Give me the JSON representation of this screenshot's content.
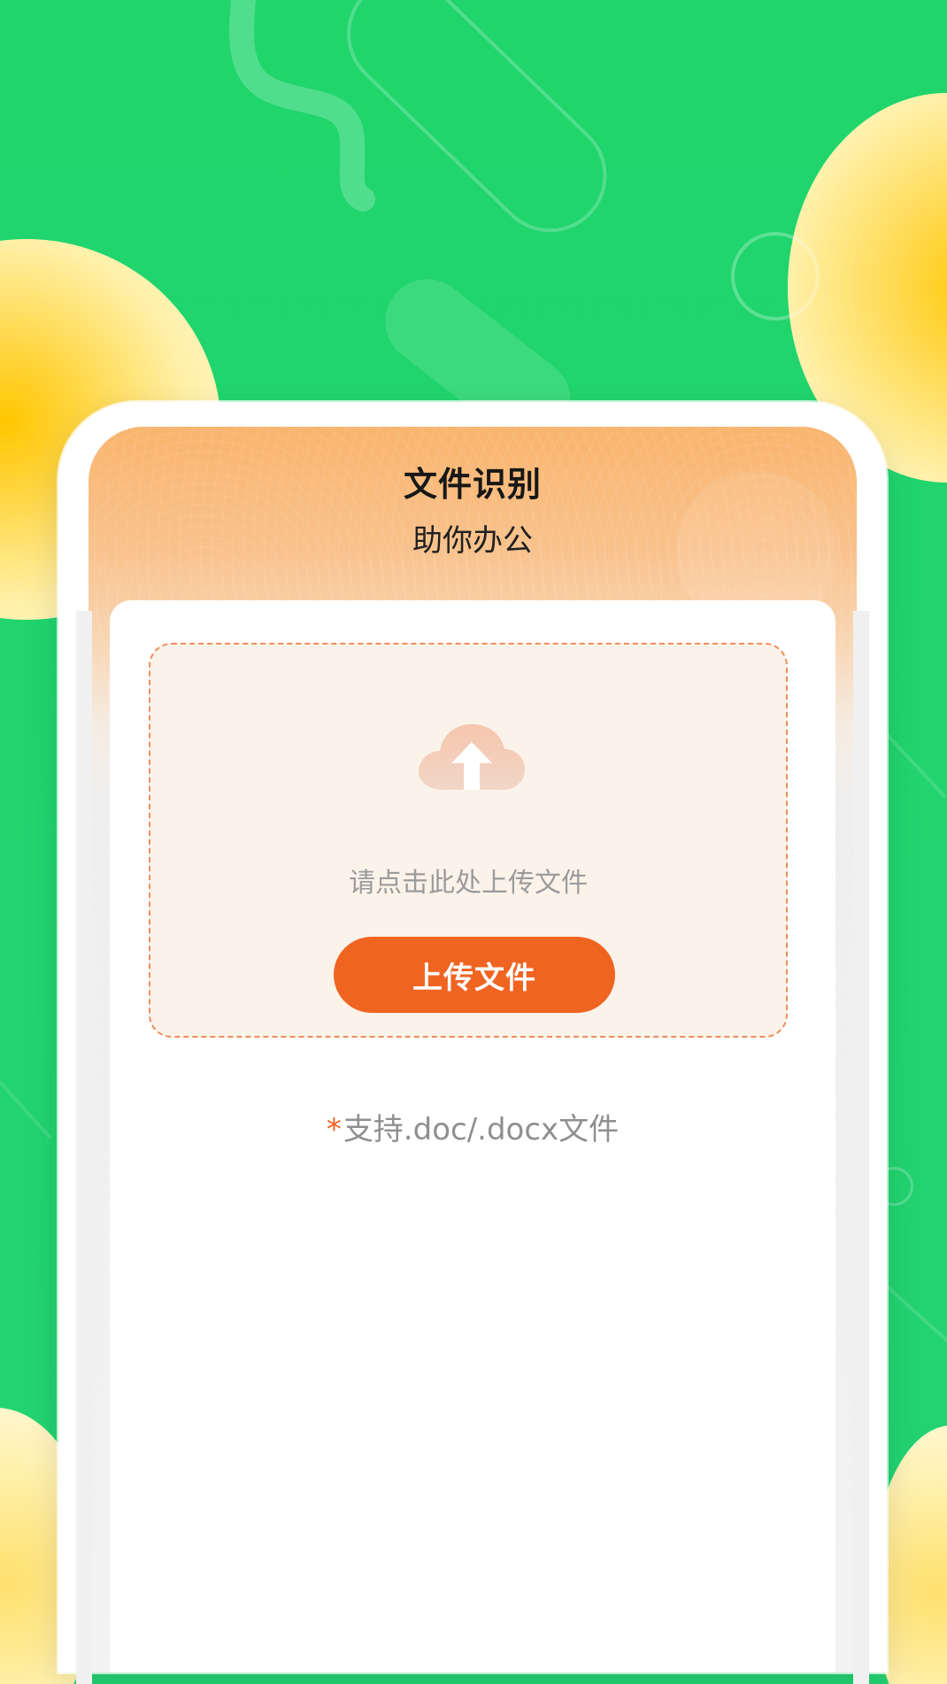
{
  "app": {
    "title": "文件识别",
    "subtitle": "助你办公"
  },
  "upload": {
    "icon": "cloud-upload-icon",
    "prompt": "请点击此处上传文件",
    "button_label": "上传文件"
  },
  "support": {
    "asterisk": "*",
    "text": "支持.doc/.docx文件"
  },
  "colors": {
    "background": "#22d36d",
    "accent": "#f06422",
    "yellow_circle": "#ffc600",
    "upload_zone_bg": "#fbf3ea"
  }
}
